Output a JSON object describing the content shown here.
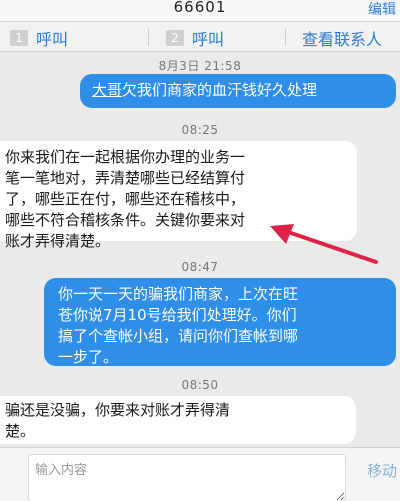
{
  "header": {
    "number": "66601",
    "edit_label": "编辑"
  },
  "actions": {
    "call1": {
      "sim": "1",
      "label": "呼叫"
    },
    "call2": {
      "sim": "2",
      "label": "呼叫"
    },
    "view_contact": "查看联系人"
  },
  "messages": [
    {
      "timestamp": "8月3日 21:58",
      "from": "me",
      "text_parts": [
        "大哥",
        "欠我们商家的血汗钱好久处理"
      ]
    },
    {
      "timestamp": "08:25",
      "from": "them",
      "lines": [
        "你来我们在一起根据你办理的业务一",
        "笔一笔地对，弄清楚哪些已经结算付",
        "了，哪些正在付，哪些还在稽核中，",
        "哪些不符合稽核条件。关键你要来对",
        "账才弄得清楚。"
      ]
    },
    {
      "timestamp": "08:47",
      "from": "me",
      "lines": [
        "你一天一天的骗我们商家，上次在旺",
        "苍你说7月10号给我们处理好。你们",
        "搞了个查帐小组，请问你们查帐到哪",
        "一步了。"
      ]
    },
    {
      "timestamp": "08:50",
      "from": "them",
      "lines": [
        "骗还是没骗，你要来对账才弄得清",
        "楚。"
      ]
    }
  ],
  "composer": {
    "placeholder": "输入内容",
    "send_label": "移动"
  },
  "annotation": {
    "arrow_color": "#e0224a"
  }
}
